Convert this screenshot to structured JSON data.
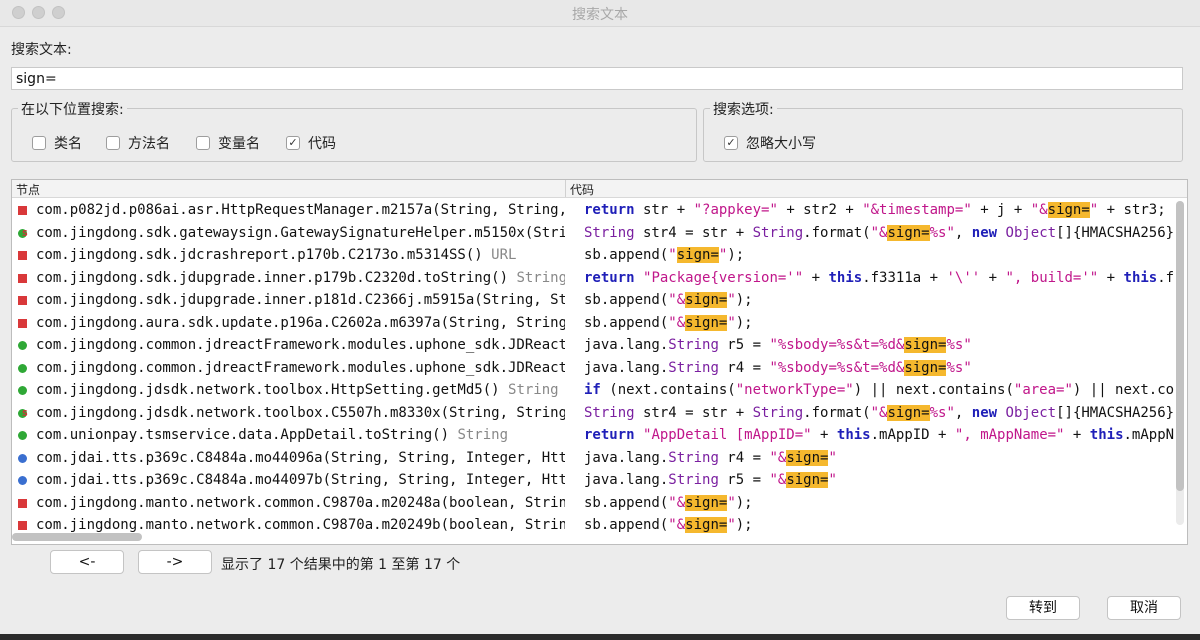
{
  "window": {
    "title": "搜索文本"
  },
  "search": {
    "label": "搜索文本:",
    "value": "sign="
  },
  "location": {
    "title": "在以下位置搜索:",
    "options": [
      {
        "label": "类名",
        "checked": false
      },
      {
        "label": "方法名",
        "checked": false
      },
      {
        "label": "变量名",
        "checked": false
      },
      {
        "label": "代码",
        "checked": true
      }
    ]
  },
  "search_options": {
    "title": "搜索选项:",
    "options": [
      {
        "label": "忽略大小写",
        "checked": true
      }
    ]
  },
  "results": {
    "col_node": "节点",
    "col_code": "代码",
    "rows": [
      {
        "icon": "method-icon",
        "node": "com.p082jd.p086ai.asr.HttpRequestManager.m2157a(String, String,",
        "suffix": "",
        "code": [
          [
            "kw",
            "return"
          ],
          [
            "p",
            " str + "
          ],
          [
            "st",
            "\"?appkey=\""
          ],
          [
            "p",
            " + str2 + "
          ],
          [
            "st",
            "\"&timestamp=\""
          ],
          [
            "p",
            " + j + "
          ],
          [
            "st",
            "\"&"
          ],
          [
            "hl",
            "sign="
          ],
          [
            "st",
            "\""
          ],
          [
            "p",
            " + str3;"
          ]
        ]
      },
      {
        "icon": "static-method-icon",
        "node": "com.jingdong.sdk.gatewaysign.GatewaySignatureHelper.m5150x(Strin",
        "suffix": "",
        "code": [
          [
            "ty",
            "String"
          ],
          [
            "p",
            " str4 = str + "
          ],
          [
            "ty",
            "String"
          ],
          [
            "p",
            ".format("
          ],
          [
            "st",
            "\"&"
          ],
          [
            "hl",
            "sign="
          ],
          [
            "st",
            "%s\""
          ],
          [
            "p",
            ", "
          ],
          [
            "kw",
            "new"
          ],
          [
            "p",
            " "
          ],
          [
            "ty",
            "Object"
          ],
          [
            "p",
            "[]{HMACSHA256})"
          ]
        ]
      },
      {
        "icon": "method-icon",
        "node": "com.jingdong.sdk.jdcrashreport.p170b.C2173o.m5314SS()",
        "suffix": " URL",
        "code": [
          [
            "p",
            "sb.append("
          ],
          [
            "st",
            "\""
          ],
          [
            "hl",
            "sign="
          ],
          [
            "st",
            "\""
          ],
          [
            "p",
            ");"
          ]
        ]
      },
      {
        "icon": "method-icon",
        "node": "com.jingdong.sdk.jdupgrade.inner.p179b.C2320d.toString()",
        "suffix": " String",
        "code": [
          [
            "kw",
            "return"
          ],
          [
            "p",
            " "
          ],
          [
            "st",
            "\"Package{version='\""
          ],
          [
            "p",
            " + "
          ],
          [
            "kw",
            "this"
          ],
          [
            "p",
            ".f3311a + "
          ],
          [
            "st",
            "'\\''"
          ],
          [
            "p",
            " + "
          ],
          [
            "st",
            "\", build='\""
          ],
          [
            "p",
            " + "
          ],
          [
            "kw",
            "this"
          ],
          [
            "p",
            ".f3"
          ]
        ]
      },
      {
        "icon": "static-method-icon-red",
        "node": "com.jingdong.sdk.jdupgrade.inner.p181d.C2366j.m5915a(String, Str",
        "suffix": "",
        "code": [
          [
            "p",
            "sb.append("
          ],
          [
            "st",
            "\"&"
          ],
          [
            "hl",
            "sign="
          ],
          [
            "st",
            "\""
          ],
          [
            "p",
            ");"
          ]
        ]
      },
      {
        "icon": "method-icon",
        "node": "com.jingdong.aura.sdk.update.p196a.C2602a.m6397a(String, String)",
        "suffix": "",
        "code": [
          [
            "p",
            "sb.append("
          ],
          [
            "st",
            "\"&"
          ],
          [
            "hl",
            "sign="
          ],
          [
            "st",
            "\""
          ],
          [
            "p",
            ");"
          ]
        ]
      },
      {
        "icon": "dot-icon",
        "node": "com.jingdong.common.jdreactFramework.modules.uphone_sdk.JDReactN",
        "suffix": "",
        "code": [
          [
            "p",
            "java.lang."
          ],
          [
            "ty",
            "String"
          ],
          [
            "p",
            " r5 = "
          ],
          [
            "st",
            "\"%sbody=%s&t=%d&"
          ],
          [
            "hl",
            "sign="
          ],
          [
            "st",
            "%s\""
          ]
        ]
      },
      {
        "icon": "dot-icon",
        "node": "com.jingdong.common.jdreactFramework.modules.uphone_sdk.JDReactN",
        "suffix": "",
        "code": [
          [
            "p",
            "java.lang."
          ],
          [
            "ty",
            "String"
          ],
          [
            "p",
            " r4 = "
          ],
          [
            "st",
            "\"%sbody=%s&t=%d&"
          ],
          [
            "hl",
            "sign="
          ],
          [
            "st",
            "%s\""
          ]
        ]
      },
      {
        "icon": "dot-icon",
        "node": "com.jingdong.jdsdk.network.toolbox.HttpSetting.getMd5()",
        "suffix": " String",
        "code": [
          [
            "kw",
            "if"
          ],
          [
            "p",
            " (next.contains("
          ],
          [
            "st",
            "\"networkType=\""
          ],
          [
            "p",
            ") || next.contains("
          ],
          [
            "st",
            "\"area=\""
          ],
          [
            "p",
            ") || next.con"
          ]
        ]
      },
      {
        "icon": "static-method-icon",
        "node": "com.jingdong.jdsdk.network.toolbox.C5507h.m8330x(String, String,",
        "suffix": "",
        "code": [
          [
            "ty",
            "String"
          ],
          [
            "p",
            " str4 = str + "
          ],
          [
            "ty",
            "String"
          ],
          [
            "p",
            ".format("
          ],
          [
            "st",
            "\"&"
          ],
          [
            "hl",
            "sign="
          ],
          [
            "st",
            "%s\""
          ],
          [
            "p",
            ", "
          ],
          [
            "kw",
            "new"
          ],
          [
            "p",
            " "
          ],
          [
            "ty",
            "Object"
          ],
          [
            "p",
            "[]{HMACSHA256})"
          ]
        ]
      },
      {
        "icon": "dot-icon",
        "node": "com.unionpay.tsmservice.data.AppDetail.toString()",
        "suffix": " String",
        "code": [
          [
            "kw",
            "return"
          ],
          [
            "p",
            " "
          ],
          [
            "st",
            "\"AppDetail [mAppID=\""
          ],
          [
            "p",
            " + "
          ],
          [
            "kw",
            "this"
          ],
          [
            "p",
            ".mAppID + "
          ],
          [
            "st",
            "\", mAppName=\""
          ],
          [
            "p",
            " + "
          ],
          [
            "kw",
            "this"
          ],
          [
            "p",
            ".mAppNa"
          ]
        ]
      },
      {
        "icon": "class-method-icon",
        "node": "com.jdai.tts.p369c.C8484a.mo44096a(String, String, Integer, Http",
        "suffix": "",
        "code": [
          [
            "p",
            "java.lang."
          ],
          [
            "ty",
            "String"
          ],
          [
            "p",
            " r4 = "
          ],
          [
            "st",
            "\"&"
          ],
          [
            "hl",
            "sign="
          ],
          [
            "st",
            "\""
          ]
        ]
      },
      {
        "icon": "class-method-icon",
        "node": "com.jdai.tts.p369c.C8484a.mo44097b(String, String, Integer, Http",
        "suffix": "",
        "code": [
          [
            "p",
            "java.lang."
          ],
          [
            "ty",
            "String"
          ],
          [
            "p",
            " r5 = "
          ],
          [
            "st",
            "\"&"
          ],
          [
            "hl",
            "sign="
          ],
          [
            "st",
            "\""
          ]
        ]
      },
      {
        "icon": "method-icon",
        "node": "com.jingdong.manto.network.common.C9870a.m20248a(boolean, String",
        "suffix": "",
        "code": [
          [
            "p",
            "sb.append("
          ],
          [
            "st",
            "\"&"
          ],
          [
            "hl",
            "sign="
          ],
          [
            "st",
            "\""
          ],
          [
            "p",
            ");"
          ]
        ]
      },
      {
        "icon": "method-icon",
        "node": "com.jingdong.manto.network.common.C9870a.m20249b(boolean, String",
        "suffix": "",
        "code": [
          [
            "p",
            "sb.append("
          ],
          [
            "st",
            "\"&"
          ],
          [
            "hl",
            "sign="
          ],
          [
            "st",
            "\""
          ],
          [
            "p",
            ");"
          ]
        ]
      }
    ]
  },
  "pager": {
    "prev_label": "<-",
    "next_label": "->",
    "status": "显示了 17 个结果中的第 1 至第 17 个"
  },
  "actions": {
    "goto_label": "转到",
    "cancel_label": "取消"
  }
}
